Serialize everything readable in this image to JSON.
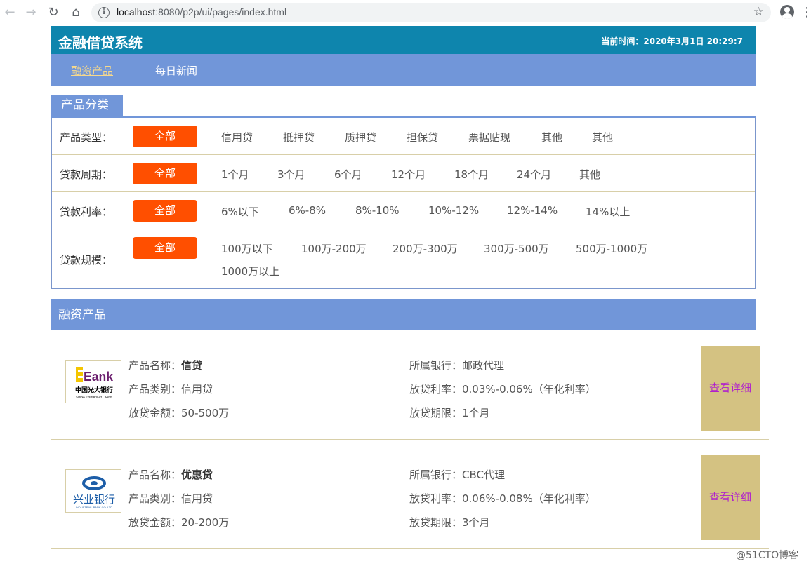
{
  "browser": {
    "url_host": "localhost",
    "url_rest": ":8080/p2p/ui/pages/index.html"
  },
  "header": {
    "logo": "金融借贷系统",
    "time": "当前时间：2020年3月1日 20:29:7"
  },
  "topnav": {
    "items": [
      {
        "label": "融资产品",
        "active": true
      },
      {
        "label": "每日新闻",
        "active": false
      }
    ]
  },
  "category": {
    "tab_label": "产品分类",
    "rows": [
      {
        "label": "产品类型：",
        "all": "全部",
        "options": [
          "信用贷",
          "抵押贷",
          "质押贷",
          "担保贷",
          "票据贴现",
          "其他",
          "其他"
        ]
      },
      {
        "label": "贷款周期：",
        "all": "全部",
        "options": [
          "1个月",
          "3个月",
          "6个月",
          "12个月",
          "18个月",
          "24个月",
          "其他"
        ]
      },
      {
        "label": "贷款利率：",
        "all": "全部",
        "options": [
          "6%以下",
          "6%-8%",
          "8%-10%",
          "10%-12%",
          "12%-14%",
          "14%以上"
        ]
      },
      {
        "label": "贷款规模：",
        "all": "全部",
        "options": [
          "100万以下",
          "100万-200万",
          "200万-300万",
          "300万-500万",
          "500万-1000万",
          "1000万以上"
        ]
      }
    ]
  },
  "products_section": {
    "title": "融资产品"
  },
  "products": [
    {
      "logo_text": "Eank",
      "logo_sub": "中国光大银行",
      "logo_sub2": "CHINA EVERBRIGHT BANK",
      "name_label": "产品名称：",
      "name": "信贷",
      "category": "产品类别：信用贷",
      "amount": "放贷金额：50-500万",
      "bank": "所属银行：邮政代理",
      "rate": "放贷利率：0.03%-0.06%（年化利率）",
      "term": "放贷期限：1个月",
      "detail_button": "查看详细"
    },
    {
      "logo_text": "兴业银行",
      "logo_sub2": "INDUSTRIAL BANK CO.,LTD",
      "name_label": "产品名称：",
      "name": "优惠贷",
      "category": "产品类别：信用贷",
      "amount": "放贷金额：20-200万",
      "bank": "所属银行：CBC代理",
      "rate": "放贷利率：0.06%-0.08%（年化利率）",
      "term": "放贷期限：3个月",
      "detail_button": "查看详细"
    }
  ],
  "watermark": "@51CTO博客"
}
